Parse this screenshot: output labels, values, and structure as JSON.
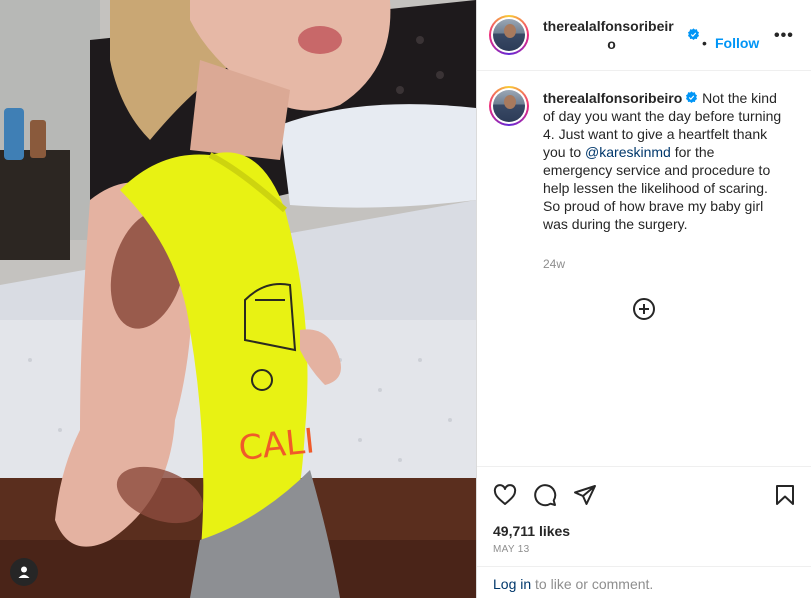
{
  "post": {
    "username": "therealalfonsoribeiro",
    "username_line1": "therealalfonsoribeir",
    "username_line2": "o",
    "dot": "•",
    "follow_label": "Follow",
    "more_label": "•••"
  },
  "caption": {
    "username": "therealalfonsoribeiro",
    "text_before_mention": "Not the kind of day you want the day before turning 4. Just want to give a heartfelt thank you to ",
    "mention": "@kareskinmd",
    "text_after_mention": " for the emergency service and procedure to help lessen the likelihood of scaring. So proud of how brave my baby girl was during the surgery.",
    "time_ago": "24w"
  },
  "stats": {
    "likes": "49,711 likes",
    "date": "MAY 13"
  },
  "login": {
    "link": "Log in",
    "rest": " to like or comment."
  },
  "icons": {
    "verified": "verified-badge-icon",
    "add_comment": "add-circle-icon",
    "like": "heart-icon",
    "comment": "speech-bubble-icon",
    "share": "paper-plane-icon",
    "save": "bookmark-icon",
    "tagged": "person-icon"
  },
  "colors": {
    "accent": "#0095f6",
    "mention": "#00376b",
    "secondary_text": "#8e8e8e",
    "divider": "#efefef"
  }
}
